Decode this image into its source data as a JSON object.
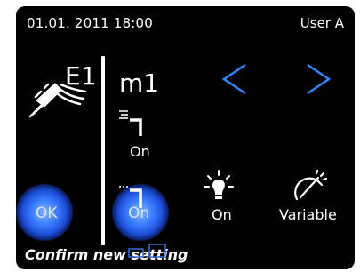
{
  "status": {
    "datetime": "01.01. 2011 18:00",
    "user": "User A"
  },
  "instrument": {
    "tool_label": "E1",
    "mode_label": "m1",
    "icon": "handpiece-icon"
  },
  "navigation": {
    "prev_label": "<",
    "next_label": ">"
  },
  "settings": {
    "spray": {
      "icon": "spray-icon",
      "value": "On"
    },
    "air": {
      "icon": "air-icon",
      "value": "On"
    },
    "light": {
      "icon": "light-bulb-icon",
      "value": "On"
    },
    "speed": {
      "icon": "speedometer-icon",
      "value": "Variable"
    }
  },
  "actions": {
    "ok_label": "OK"
  },
  "message": "Confirm new setting",
  "colors": {
    "background": "#000000",
    "text": "#ffffff",
    "accent": "#2f86ff",
    "glow": "#3b7cff"
  }
}
